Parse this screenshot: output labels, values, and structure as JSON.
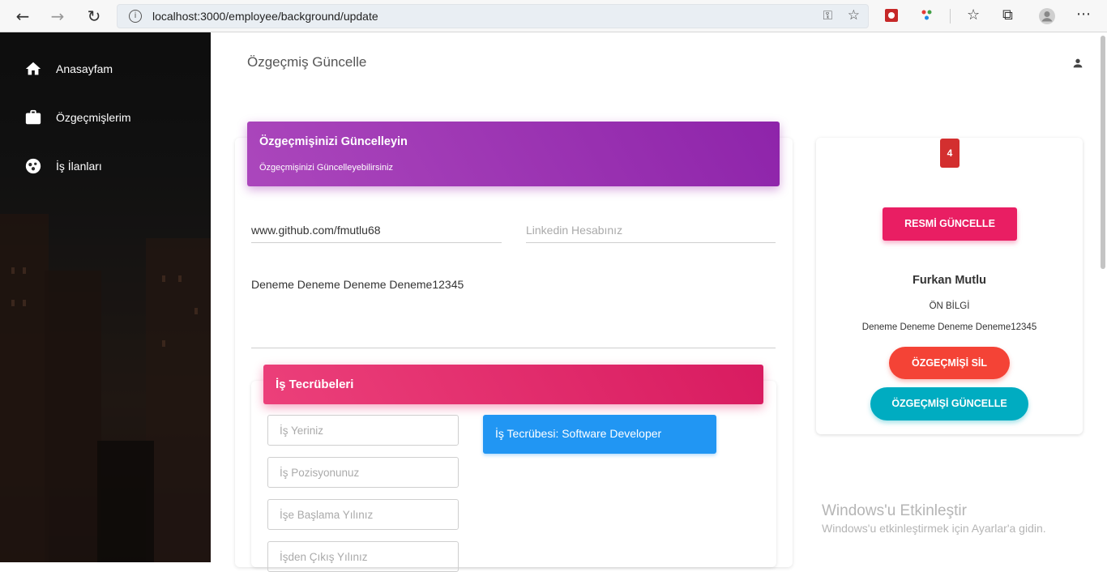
{
  "browser": {
    "url": "localhost:3000/employee/background/update"
  },
  "sidebar": {
    "items": [
      {
        "label": "Anasayfam",
        "icon": "home-icon"
      },
      {
        "label": "Özgeçmişlerim",
        "icon": "briefcase-icon"
      },
      {
        "label": "İş İlanları",
        "icon": "bubble-chart-icon"
      }
    ]
  },
  "main": {
    "title": "Özgeçmiş Güncelle"
  },
  "form_card": {
    "title": "Özgeçmişinizi Güncelleyin",
    "subtitle": "Özgeçmişinizi Güncelleyebilirsiniz",
    "github_value": "www.github.com/fmutlu68",
    "linkedin_placeholder": "Linkedin Hesabınız",
    "summary_value": "Deneme Deneme Deneme Deneme12345"
  },
  "experience": {
    "title": "İş Tecrübeleri",
    "workplace_placeholder": "İş Yeriniz",
    "position_placeholder": "İş Pozisyonunuz",
    "start_placeholder": "İşe Başlama Yılınız",
    "end_placeholder": "İşden Çıkış Yılınız",
    "item": "İş Tecrübesi: Software Developer"
  },
  "profile": {
    "avatar_text": "4",
    "update_image_label": "RESMİ GÜNCELLE",
    "name": "Furkan Mutlu",
    "pre_info_label": "ÖN BİLGİ",
    "pre_info_text": "Deneme Deneme Deneme Deneme12345",
    "delete_label": "ÖZGEÇMİŞİ SİL",
    "update_label": "ÖZGEÇMİŞİ GÜNCELLE"
  },
  "windows": {
    "activate_title": "Windows'u Etkinleştir",
    "activate_text": "Windows'u etkinleştirmek için Ayarlar'a gidin."
  },
  "colors": {
    "purple": "#9c27b0",
    "pink": "#e91e63",
    "red": "#f44336",
    "cyan": "#00acc1",
    "blue": "#2196f3"
  }
}
